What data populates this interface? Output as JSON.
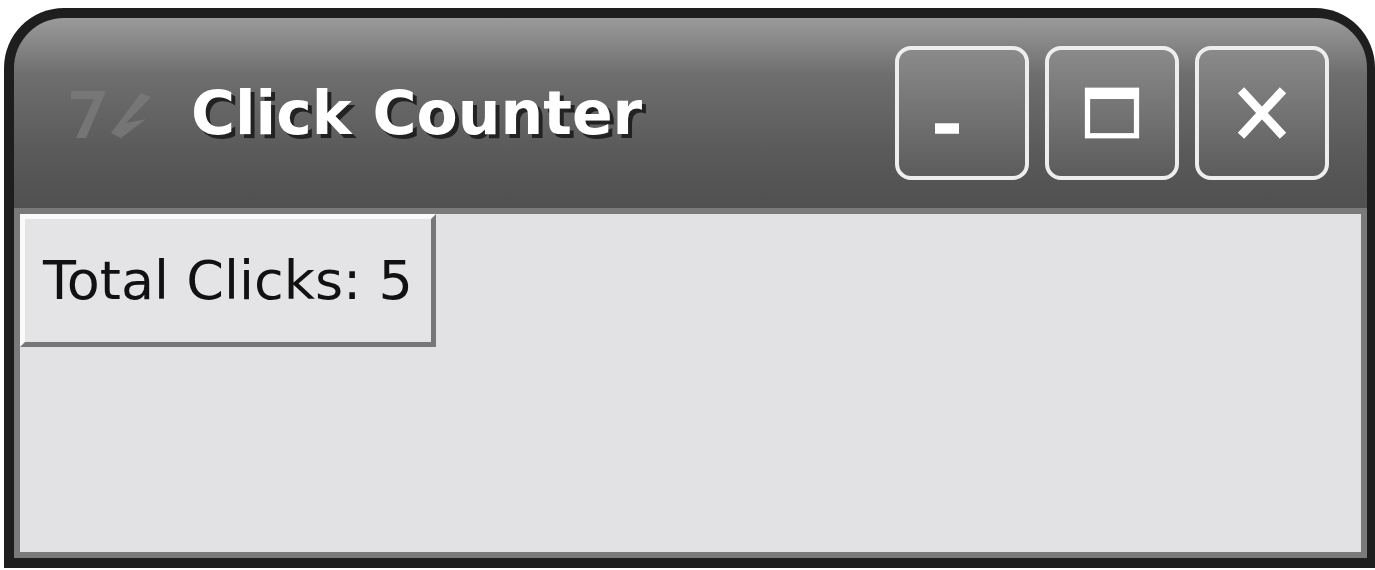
{
  "window": {
    "title": "Click Counter"
  },
  "buttons": [
    {
      "label": "Total Clicks: 5"
    }
  ]
}
